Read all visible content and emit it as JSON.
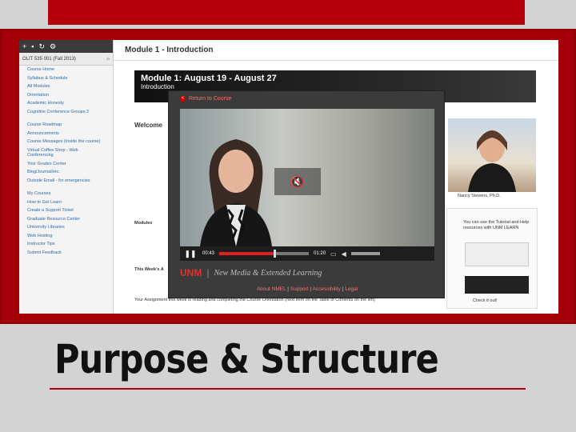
{
  "sidebar": {
    "course": "OLIT 535 001 (Fall 2013)",
    "items": [
      "Course Home",
      "Syllabus & Schedule",
      "All Modules",
      "Orientation",
      "Academic Honesty",
      "Cognitive Conference Groups 2"
    ],
    "items2": [
      "Course Roadmap",
      "Announcements",
      "Course Messages (Inside the course)",
      "Virtual Coffee Shop - Web Conferencing",
      "Your Grades Center",
      "Blog/Journal/etc.",
      "Outside Email - for emergencies"
    ],
    "items3": [
      "My Courses",
      "How to Get Learn",
      "Create a Support Ticket",
      "Graduate Resource Center",
      "University Libraries",
      "Web Hosting",
      "Instructor Tips",
      "Submit Feedback"
    ]
  },
  "main": {
    "title": "Module 1 - Introduction",
    "banner_title": "Module 1: August 19 - August 27",
    "banner_sub": "Introduction",
    "welcome": "Welcome",
    "modules_heading": "Modules",
    "this_week": "This Week's A",
    "assignment": "Your Assignment this week is reading and completing the Course Orientation (next item on the Table of Contents on the left)",
    "photo_caption": "Nancy Stevens, Ph.D.",
    "right_box_text": "You can use the Tutorial and Help resources with UNM LEARN",
    "right_box_cta": "Check it out!"
  },
  "video": {
    "return_label": "Return to Course",
    "time_current": "00:43",
    "time_total": "01:20",
    "progress": 0.62,
    "unm_logo": "UNM",
    "unm_tagline": "New Media & Extended Learning",
    "links": [
      "About NMEL",
      "Support",
      "Accessibility",
      "Legal"
    ]
  },
  "slide": {
    "title": "Purpose & Structure"
  },
  "colors": {
    "accent": "#b3000c"
  }
}
